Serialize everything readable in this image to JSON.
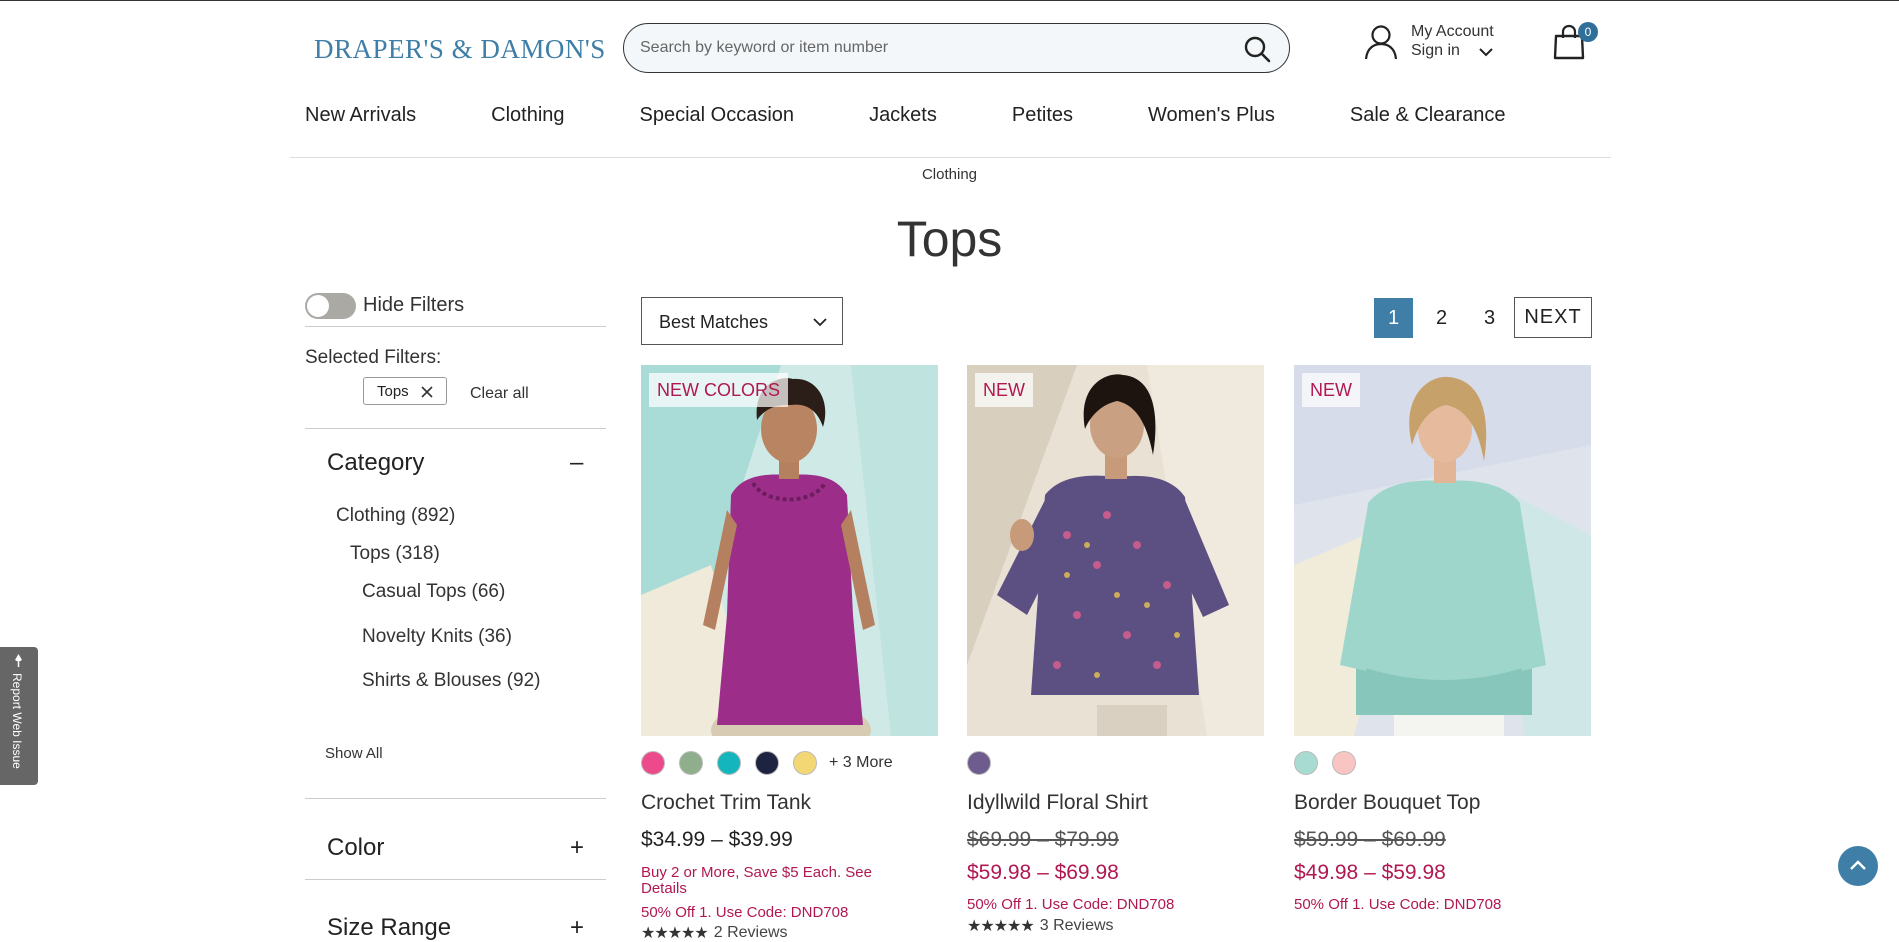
{
  "brand": {
    "logo_text": "DRAPER'S & DAMON'S",
    "accent": "#3f7ea6",
    "sale_color": "#b01852"
  },
  "search": {
    "placeholder": "Search by keyword or item number",
    "icon": "search-icon"
  },
  "account": {
    "line1": "My Account",
    "line2": "Sign in",
    "icon": "user-icon"
  },
  "cart": {
    "count": "0",
    "icon": "shopping-bag-icon"
  },
  "nav": {
    "items": [
      "New Arrivals",
      "Clothing",
      "Special Occasion",
      "Jackets",
      "Petites",
      "Women's Plus",
      "Sale & Clearance"
    ]
  },
  "breadcrumb": "Clothing",
  "page_title": "Tops",
  "filters": {
    "toggle_label": "Hide Filters",
    "selected_label": "Selected Filters:",
    "chip": "Tops",
    "clear_all": "Clear all",
    "category": {
      "title": "Category",
      "sign": "–",
      "items": [
        "Clothing (892)",
        "Tops (318)",
        "Casual Tops (66)",
        "Novelty Knits (36)",
        "Shirts & Blouses (92)"
      ],
      "show_all": "Show All"
    },
    "color": {
      "title": "Color",
      "sign": "+"
    },
    "size_range": {
      "title": "Size Range",
      "sign": "+"
    }
  },
  "report_tab": "Report Web Issue",
  "sort": {
    "selected": "Best Matches"
  },
  "pagination": {
    "pages": [
      "1",
      "2",
      "3"
    ],
    "current": "1",
    "next": "NEXT"
  },
  "products": [
    {
      "badge": "NEW COLORS",
      "swatches": [
        "#ec4a8b",
        "#8fae8c",
        "#15b5bd",
        "#1d2340",
        "#f4d775"
      ],
      "more": "+ 3 More",
      "name": "Crochet Trim Tank",
      "price": "$34.99 – $39.99",
      "promo1": "Buy 2 or More, Save $5 Each. See Details",
      "promo2": "50% Off 1. Use Code: DND708",
      "stars": "★★★★★",
      "reviews": "2 Reviews"
    },
    {
      "badge": "NEW",
      "swatches": [
        "#6e5c8e"
      ],
      "name": "Idyllwild Floral Shirt",
      "old_price": "$69.99 – $79.99",
      "sale_price": "$59.98 – $69.98",
      "promo": "50% Off 1. Use Code: DND708",
      "stars": "★★★★★",
      "reviews": "3 Reviews"
    },
    {
      "badge": "NEW",
      "swatches": [
        "#a8dcd2",
        "#f9c5c3"
      ],
      "name": "Border Bouquet Top",
      "old_price": "$59.99 – $69.99",
      "sale_price": "$49.98 – $59.98",
      "promo": "50% Off 1. Use Code: DND708"
    }
  ]
}
